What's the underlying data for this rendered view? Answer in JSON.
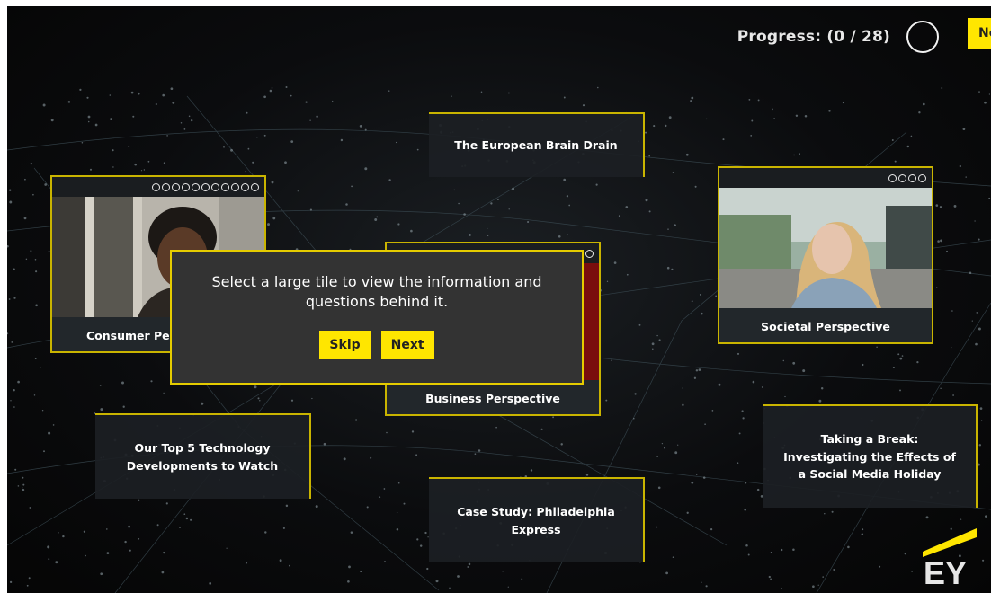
{
  "header": {
    "progress_text": "Progress: (0 / 28)",
    "next_label": "Next"
  },
  "tiles": {
    "european_brain_drain": "The European Brain Drain",
    "top5_tech_line1": "Our Top 5 Technology",
    "top5_tech_line2": "Developments to Watch",
    "case_study_line1": "Case Study: Philadelphia",
    "case_study_line2": "Express",
    "break_line1": "Taking a Break:",
    "break_line2": "Investigating the Effects of",
    "break_line3": "a Social Media Holiday"
  },
  "big_tiles": {
    "consumer_label": "Consumer Pe",
    "consumer_dots": 11,
    "business_label": "Business Perspective",
    "business_dots": 7,
    "societal_label": "Societal Perspective",
    "societal_dots": 4
  },
  "modal": {
    "line1": "Select a large tile to view the information and",
    "line2": "questions behind it.",
    "skip_label": "Skip",
    "next_label": "Next"
  },
  "brand": {
    "logo_text": "EY",
    "accent_color": "#ffe600"
  }
}
